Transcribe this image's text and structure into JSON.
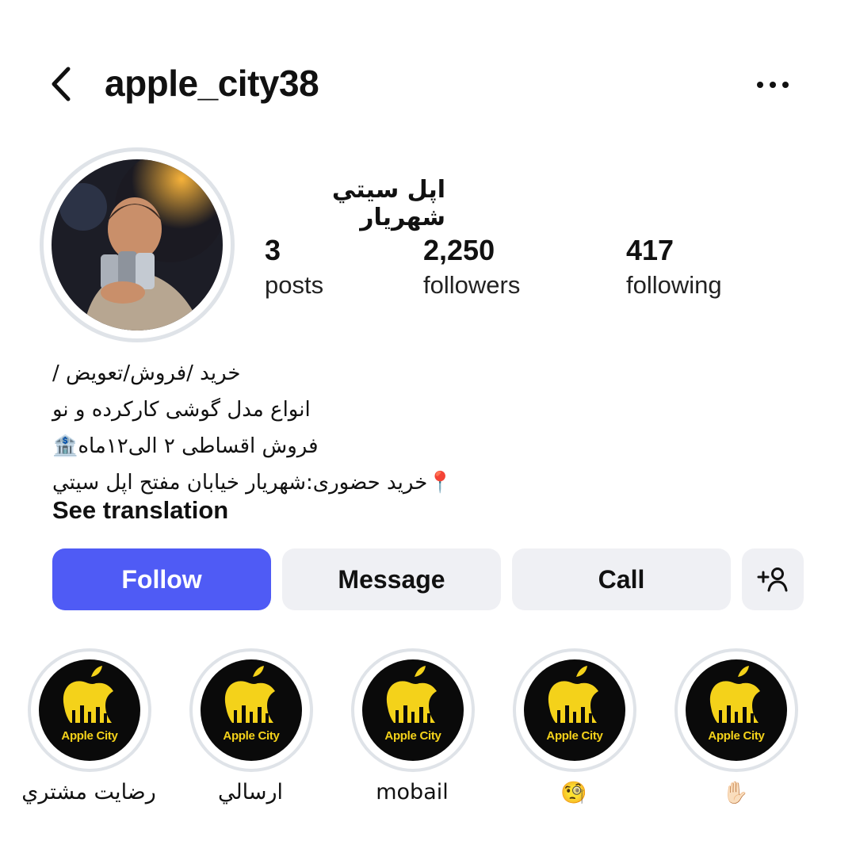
{
  "header": {
    "username": "apple_city38"
  },
  "profile": {
    "display_name": "اپل سيتي شهريار",
    "stats": [
      {
        "value": "3",
        "label": "posts"
      },
      {
        "value": "2,250",
        "label": "followers"
      },
      {
        "value": "417",
        "label": "following"
      }
    ],
    "bio_lines": [
      "خرید /فروش/تعویض /",
      "انواع مدل گوشی کارکرده و نو",
      "فروش اقساطی ۲ الی۱۲ماه🏦",
      "📍خرید حضوری:شهریار خیابان مفتح اپل سيتي"
    ],
    "see_translation": "See translation"
  },
  "actions": {
    "follow": "Follow",
    "message": "Message",
    "call": "Call"
  },
  "highlights": [
    {
      "label": "رضايت مشتري",
      "brand": "Apple City"
    },
    {
      "label": "ارسالي",
      "brand": "Apple City"
    },
    {
      "label": "mobail",
      "brand": "Apple City"
    },
    {
      "label": "🧐",
      "brand": "Apple City"
    },
    {
      "label": "✋🏻",
      "brand": "Apple City"
    }
  ],
  "colors": {
    "follow_button": "#4f5bf5",
    "secondary_button": "#eff0f4",
    "highlight_logo": "#f4d21a"
  },
  "icons": {
    "back": "chevron-left-icon",
    "more": "more-horizontal-icon",
    "add_person": "add-person-icon"
  }
}
